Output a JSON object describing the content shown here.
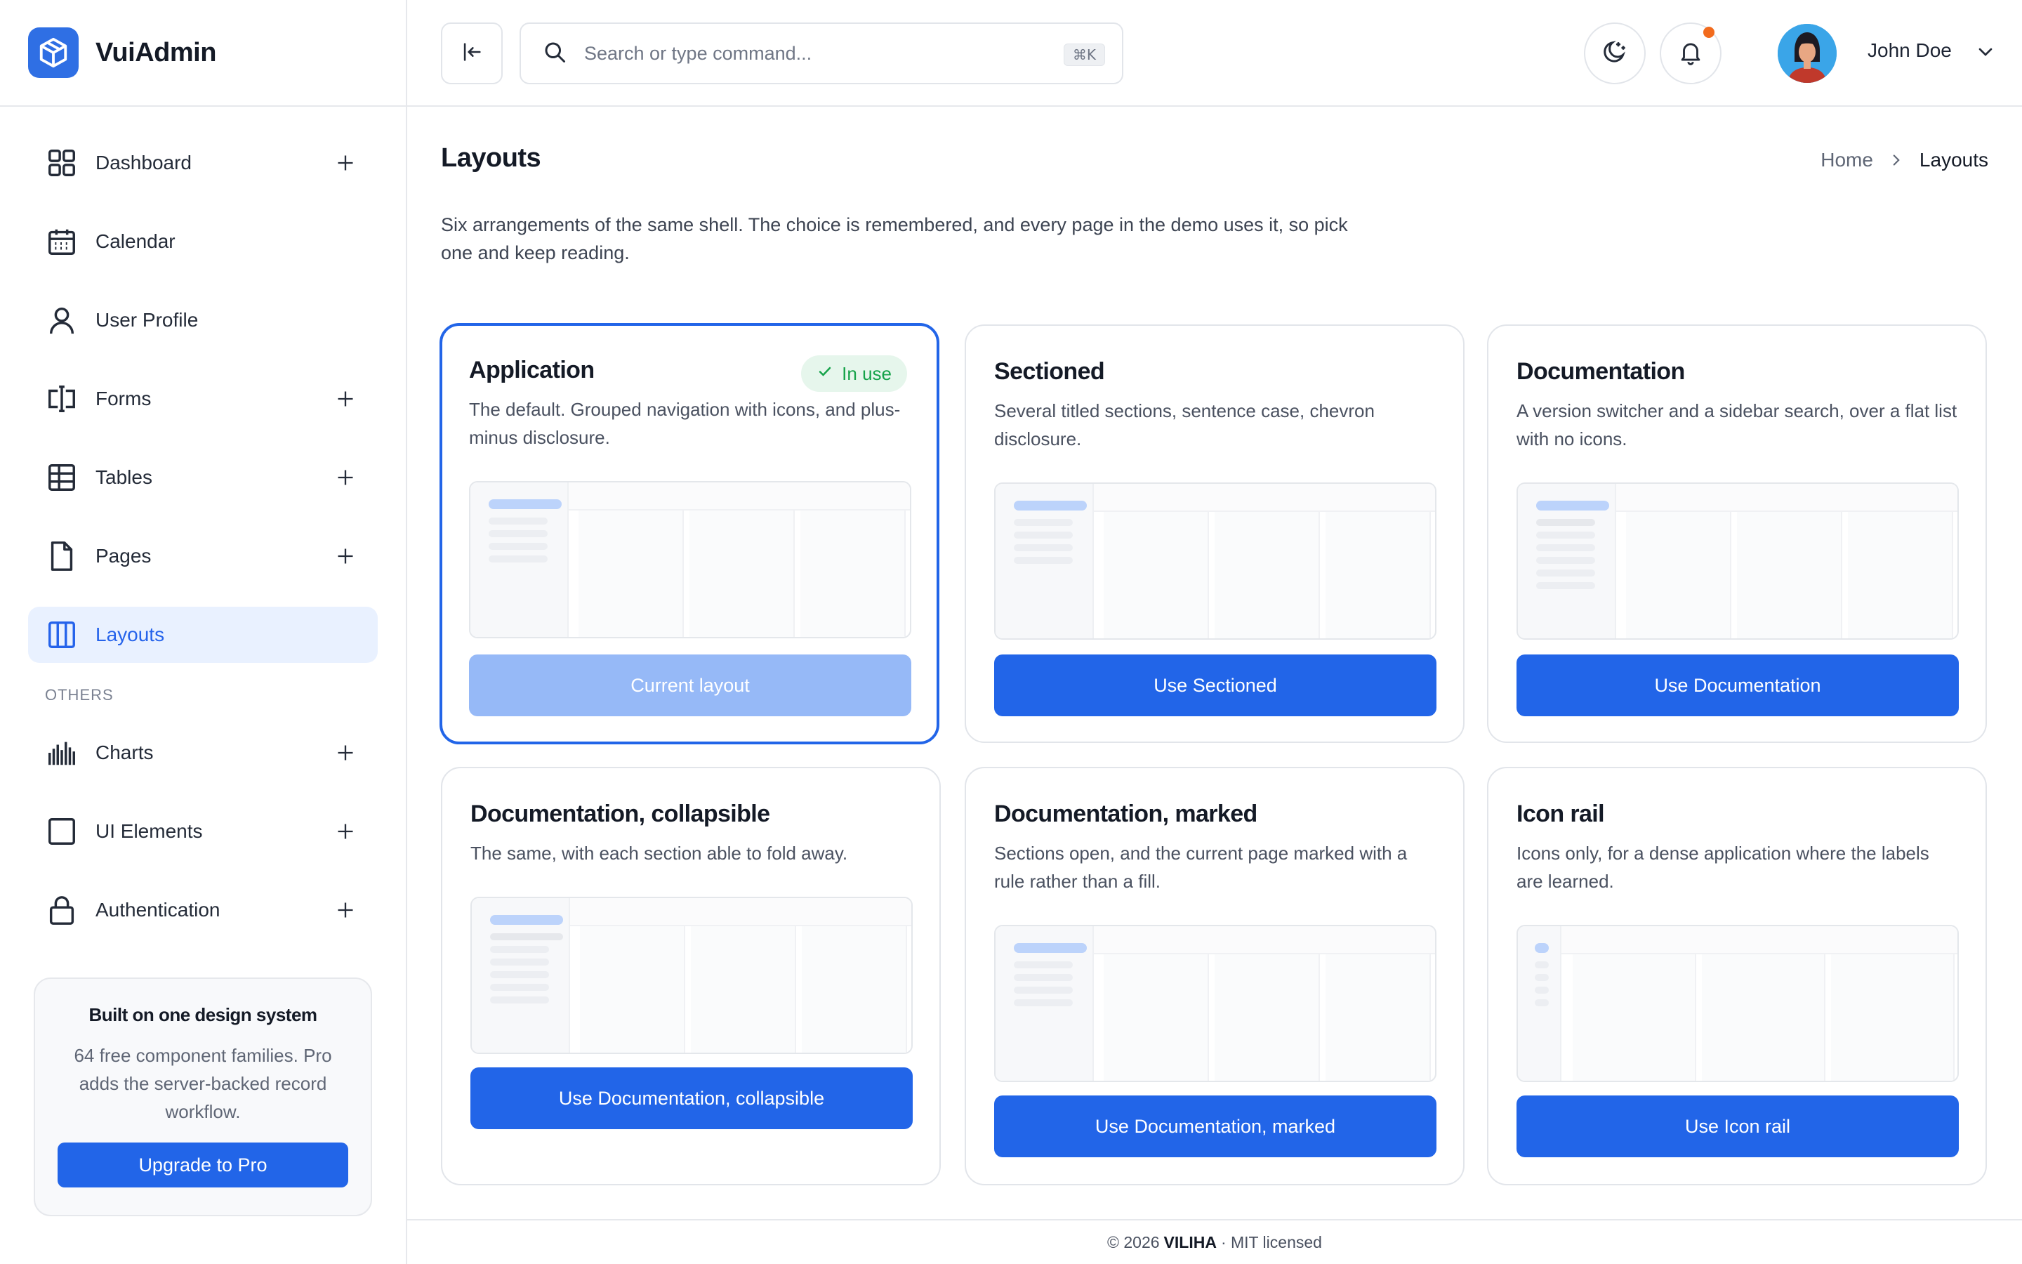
{
  "brand": {
    "name": "VuiAdmin",
    "logo_icon": "cube-icon",
    "accent": "#2f6fe4"
  },
  "sidebar": {
    "items": [
      {
        "label": "Dashboard",
        "icon": "grid-icon",
        "expandable": true
      },
      {
        "label": "Calendar",
        "icon": "calendar-icon",
        "expandable": false
      },
      {
        "label": "User Profile",
        "icon": "user-icon",
        "expandable": false
      },
      {
        "label": "Forms",
        "icon": "form-icon",
        "expandable": true
      },
      {
        "label": "Tables",
        "icon": "table-icon",
        "expandable": true
      },
      {
        "label": "Pages",
        "icon": "page-icon",
        "expandable": true
      },
      {
        "label": "Layouts",
        "icon": "columns-icon",
        "expandable": false,
        "active": true
      }
    ],
    "section_label": "OTHERS",
    "other_items": [
      {
        "label": "Charts",
        "icon": "bar-chart-icon",
        "expandable": true
      },
      {
        "label": "UI Elements",
        "icon": "square-icon",
        "expandable": true
      },
      {
        "label": "Authentication",
        "icon": "lock-icon",
        "expandable": true
      }
    ],
    "promo": {
      "title": "Built on one design system",
      "text": "64 free component families. Pro adds the server-backed record workflow.",
      "button": "Upgrade to Pro"
    }
  },
  "topbar": {
    "search_placeholder": "Search or type command...",
    "search_shortcut": "⌘K",
    "user_name": "John Doe",
    "notification_dot_color": "#f26b1d"
  },
  "page": {
    "title": "Layouts",
    "breadcrumb": {
      "home": "Home",
      "current": "Layouts"
    },
    "intro": "Six arrangements of the same shell. The choice is remembered, and every page in the demo uses it, so pick one and keep reading."
  },
  "layouts": [
    {
      "title": "Application",
      "desc": "The default. Grouped navigation with icons, and plus-minus disclosure.",
      "button": "Current layout",
      "badge": "In use"
    },
    {
      "title": "Sectioned",
      "desc": "Several titled sections, sentence case, chevron disclosure.",
      "button": "Use Sectioned"
    },
    {
      "title": "Documentation",
      "desc": "A version switcher and a sidebar search, over a flat list with no icons.",
      "button": "Use Documentation"
    },
    {
      "title": "Documentation, collapsible",
      "desc": "The same, with each section able to fold away.",
      "button": "Use Documentation, collapsible"
    },
    {
      "title": "Documentation, marked",
      "desc": "Sections open, and the current page marked with a rule rather than a fill.",
      "button": "Use Documentation, marked"
    },
    {
      "title": "Icon rail",
      "desc": "Icons only, for a dense application where the labels are learned.",
      "button": "Use Icon rail"
    }
  ],
  "footer": {
    "prefix": "© 2026",
    "brand": "VILIHA",
    "suffix": "· MIT licensed"
  }
}
